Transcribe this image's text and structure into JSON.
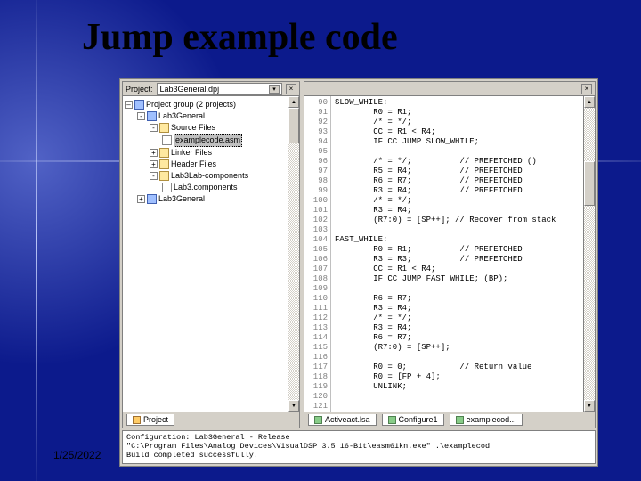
{
  "slide": {
    "title": "Jump example code",
    "date": "1/25/2022"
  },
  "projectPane": {
    "headerLabel": "Project:",
    "dropdown": "Lab3General.dpj",
    "tree": {
      "root": "Project group (2 projects)",
      "items": [
        {
          "name": "Lab3General",
          "exp": "-"
        },
        {
          "name": "Source Files",
          "exp": "-"
        },
        {
          "name": "examplecode.asm",
          "sel": true
        },
        {
          "name": "Linker Files",
          "exp": "+"
        },
        {
          "name": "Header Files",
          "exp": "+"
        },
        {
          "name": "Lab3Lab-components",
          "exp": "-"
        },
        {
          "name": "Lab3.components"
        },
        {
          "name": "Lab3General",
          "exp": "+"
        }
      ]
    },
    "tabLabel": "Project"
  },
  "codePane": {
    "gutterStart": 90,
    "gutterCount": 35,
    "lines": [
      "SLOW_WHILE:",
      "        R0 = R1;",
      "        /* = */;",
      "        CC = R1 < R4;",
      "        IF CC JUMP SLOW_WHILE;",
      "",
      "        /* = */;          // PREFETCHED ()",
      "        R5 = R4;          // PREFETCHED",
      "        R6 = R7;          // PREFETCHED",
      "        R3 = R4;          // PREFETCHED",
      "        /* = */;",
      "        R3 = R4;",
      "        (R7:0) = [SP++]; // Recover from stack",
      "",
      "FAST_WHILE:",
      "        R0 = R1;          // PREFETCHED",
      "        R3 = R3;          // PREFETCHED",
      "        CC = R1 < R4;",
      "        IF CC JUMP FAST_WHILE; (BP);",
      "",
      "        R6 = R7;",
      "        R3 = R4;",
      "        /* = */;",
      "        R3 = R4;",
      "        R6 = R7;",
      "        (R7:0) = [SP++];",
      "",
      "        R0 = 0;           // Return value",
      "        R0 = [FP + 4];",
      "        UNLINK;"
    ],
    "tabs": {
      "t1": "Activeact.lsa",
      "t2": "Configure1",
      "t3": "examplecod..."
    }
  },
  "output": {
    "line1": "              Configuration: Lab3General - Release",
    "line2": "\"C:\\Program Files\\Analog Devices\\VisualDSP 3.5 16-Bit\\easm61kn.exe\" .\\examplecod",
    "line3": "Build completed successfully."
  }
}
